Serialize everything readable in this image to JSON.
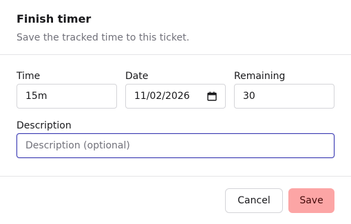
{
  "dialog": {
    "title": "Finish timer",
    "subtitle": "Save the tracked time to this ticket."
  },
  "fields": {
    "time": {
      "label": "Time",
      "value": "15m"
    },
    "date": {
      "label": "Date",
      "value": "11/02/2026"
    },
    "remaining": {
      "label": "Remaining",
      "value": "30"
    },
    "description": {
      "label": "Description",
      "placeholder": "Description (optional)",
      "value": ""
    }
  },
  "buttons": {
    "cancel_label": "Cancel",
    "save_label": "Save"
  },
  "colors": {
    "focus_border": "#3b3bb3",
    "save_bg": "#fca5a5"
  }
}
